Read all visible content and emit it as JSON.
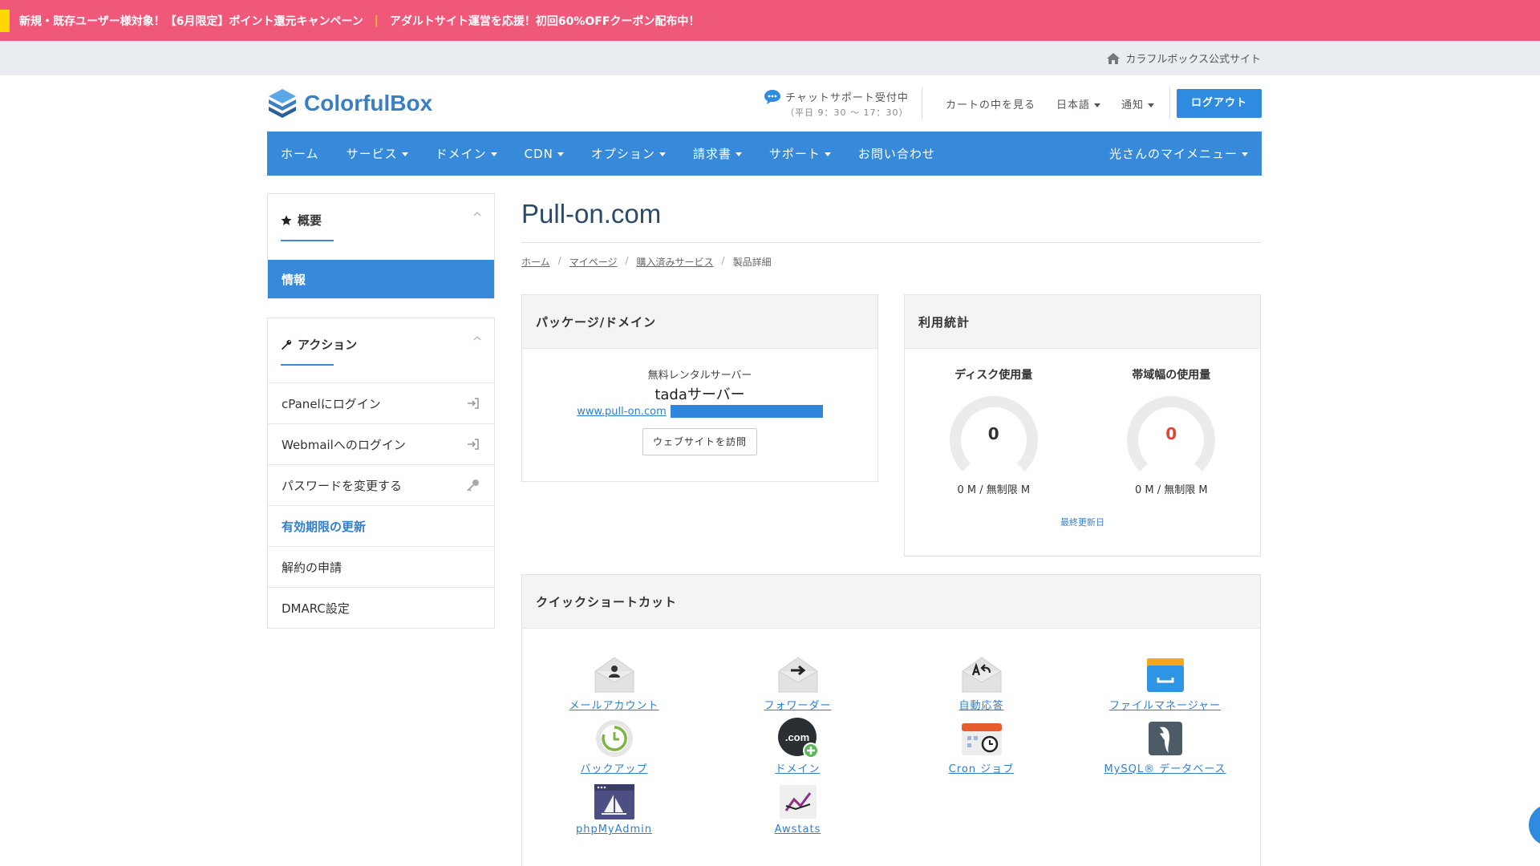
{
  "promo": {
    "text1": "新規・既存ユーザー様対象！【6月限定】ポイント還元キャンペーン",
    "separator": "|",
    "text2": "アダルトサイト運営を応援！初回60%OFFクーポン配布中！"
  },
  "official_link": "カラフルボックス公式サイト",
  "header": {
    "logo": "ColorfulBox",
    "chat_title": "チャットサポート受付中",
    "chat_hours": "（平日 9：30 〜 17：30）",
    "cart": "カートの中を見る",
    "language": "日本語",
    "notify": "通知",
    "logout": "ログアウト"
  },
  "nav": {
    "items": [
      "ホーム",
      "サービス",
      "ドメイン",
      "CDN",
      "オプション",
      "請求書",
      "サポート",
      "お問い合わせ"
    ],
    "my_menu": "光さんのマイメニュー"
  },
  "sidebar": {
    "overview_title": "概要",
    "info": "情報",
    "actions_title": "アクション",
    "actions": [
      "cPanelにログイン",
      "Webmailへのログイン",
      "パスワードを変更する",
      "有効期限の更新",
      "解約の申請",
      "DMARC設定"
    ]
  },
  "main": {
    "title": "Pull-on.com",
    "breadcrumb": [
      "ホーム",
      "マイページ",
      "購入済みサービス",
      "製品詳細"
    ],
    "package": {
      "heading": "パッケージ/ドメイン",
      "plan_type": "無料レンタルサーバー",
      "plan_name": "tadaサーバー",
      "domain": "www.pull-on.com",
      "visit": "ウェブサイトを訪問"
    },
    "stats": {
      "heading": "利用統計",
      "disk_title": "ディスク使用量",
      "disk_value": "0",
      "disk_sub": "0 M / 無制限 M",
      "bw_title": "帯域幅の使用量",
      "bw_value": "0",
      "bw_sub": "0 M / 無制限 M",
      "last_update": "最終更新日"
    },
    "shortcuts": {
      "heading": "クイックショートカット",
      "items": [
        "メールアカウント",
        "フォワーダー",
        "自動応答",
        "ファイルマネージャー",
        "バックアップ",
        "ドメイン",
        "Cron ジョブ",
        "MySQL® データベース",
        "phpMyAdmin",
        "Awstats"
      ]
    }
  },
  "colors": {
    "promo_bg": "#f0587a",
    "brand_blue": "#368ad9",
    "accent_red": "#e0443a"
  }
}
